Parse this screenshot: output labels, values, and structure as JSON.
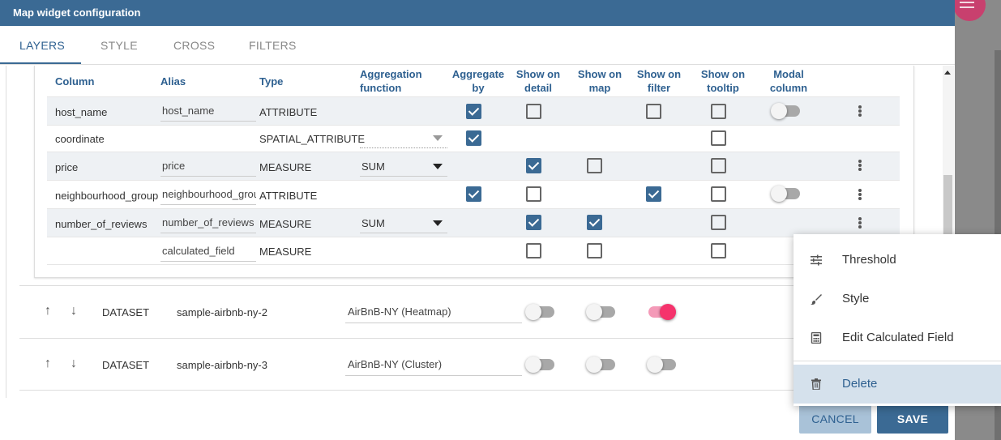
{
  "dialog": {
    "title": "Map widget configuration",
    "tabs": [
      {
        "label": "LAYERS",
        "active": true
      },
      {
        "label": "STYLE",
        "active": false
      },
      {
        "label": "CROSS",
        "active": false
      },
      {
        "label": "FILTERS",
        "active": false
      }
    ]
  },
  "field_table": {
    "headers": {
      "column": "Column",
      "alias": "Alias",
      "type": "Type",
      "aggregation_l1": "Aggregation",
      "aggregation_l2": "function",
      "aggregate_by_l1": "Aggregate",
      "aggregate_by_l2": "by",
      "show_detail_l1": "Show on",
      "show_detail_l2": "detail",
      "show_map_l1": "Show on",
      "show_map_l2": "map",
      "show_filter_l1": "Show on",
      "show_filter_l2": "filter",
      "show_tooltip_l1": "Show on",
      "show_tooltip_l2": "tooltip",
      "modal_l1": "Modal",
      "modal_l2": "column"
    },
    "rows": [
      {
        "column": "host_name",
        "alias": "host_name",
        "type": "ATTRIBUTE",
        "aggregation": "",
        "aggregate_by": true,
        "show_detail": false,
        "show_map": null,
        "show_filter": false,
        "show_tooltip": false,
        "modal": false,
        "menu": true
      },
      {
        "column": "coordinate",
        "alias": "",
        "type": "SPATIAL_ATTRIBUTE",
        "aggregation": "",
        "aggregate_by": true,
        "show_detail": null,
        "show_map": null,
        "show_filter": null,
        "show_tooltip": false,
        "modal": null,
        "menu": false
      },
      {
        "column": "price",
        "alias": "price",
        "type": "MEASURE",
        "aggregation": "SUM",
        "aggregate_by": null,
        "show_detail": true,
        "show_map": false,
        "show_filter": null,
        "show_tooltip": false,
        "modal": null,
        "menu": true
      },
      {
        "column": "neighbourhood_group",
        "alias": "neighbourhood_grou",
        "type": "ATTRIBUTE",
        "aggregation": "",
        "aggregate_by": true,
        "show_detail": false,
        "show_map": null,
        "show_filter": true,
        "show_tooltip": false,
        "modal": false,
        "menu": true
      },
      {
        "column": "number_of_reviews",
        "alias": "number_of_reviews",
        "type": "MEASURE",
        "aggregation": "SUM",
        "aggregate_by": null,
        "show_detail": true,
        "show_map": true,
        "show_filter": null,
        "show_tooltip": false,
        "modal": null,
        "menu": true
      },
      {
        "column": "",
        "alias": "calculated_field",
        "type": "MEASURE",
        "aggregation": "",
        "aggregate_by": null,
        "show_detail": false,
        "show_map": false,
        "show_filter": null,
        "show_tooltip": false,
        "modal": null,
        "menu": false
      }
    ]
  },
  "datasets": [
    {
      "kind": "DATASET",
      "name": "sample-airbnb-ny-2",
      "layer": "AirBnB-NY (Heatmap)",
      "toggles": [
        false,
        false,
        true
      ]
    },
    {
      "kind": "DATASET",
      "name": "sample-airbnb-ny-3",
      "layer": "AirBnB-NY (Cluster)",
      "toggles": [
        false,
        false,
        false
      ]
    }
  ],
  "buttons": {
    "cancel": "CANCEL",
    "save": "SAVE"
  },
  "context_menu": {
    "items": [
      {
        "label": "Threshold",
        "icon": "tune-icon"
      },
      {
        "label": "Style",
        "icon": "brush-icon"
      },
      {
        "label": "Edit Calculated Field",
        "icon": "calculator-icon"
      },
      {
        "label": "Delete",
        "icon": "trash-icon",
        "selected": true
      }
    ]
  },
  "colors": {
    "primary": "#3b6a94",
    "toggle_on": "#f5336c",
    "selected_row": "#d5e1ec"
  }
}
